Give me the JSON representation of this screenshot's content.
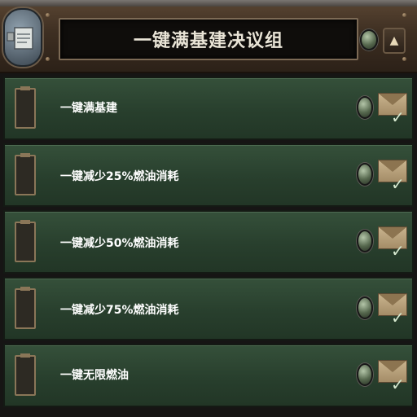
{
  "header": {
    "title": "一键满基建决议组",
    "collapse_icon": "chevron-up-icon"
  },
  "decisions": [
    {
      "label": "一键满基建"
    },
    {
      "label": "一键减少25%燃油消耗"
    },
    {
      "label": "一键减少50%燃油消耗"
    },
    {
      "label": "一键减少75%燃油消耗"
    },
    {
      "label": "一键无限燃油"
    }
  ],
  "icons": {
    "status": "green-status-dot",
    "decision": "clipboard-icon",
    "confirm": "envelope-check-icon"
  },
  "colors": {
    "panel_green": "#2e4632",
    "header_brown": "#3e2f22",
    "title_text": "#e9e4d6"
  }
}
